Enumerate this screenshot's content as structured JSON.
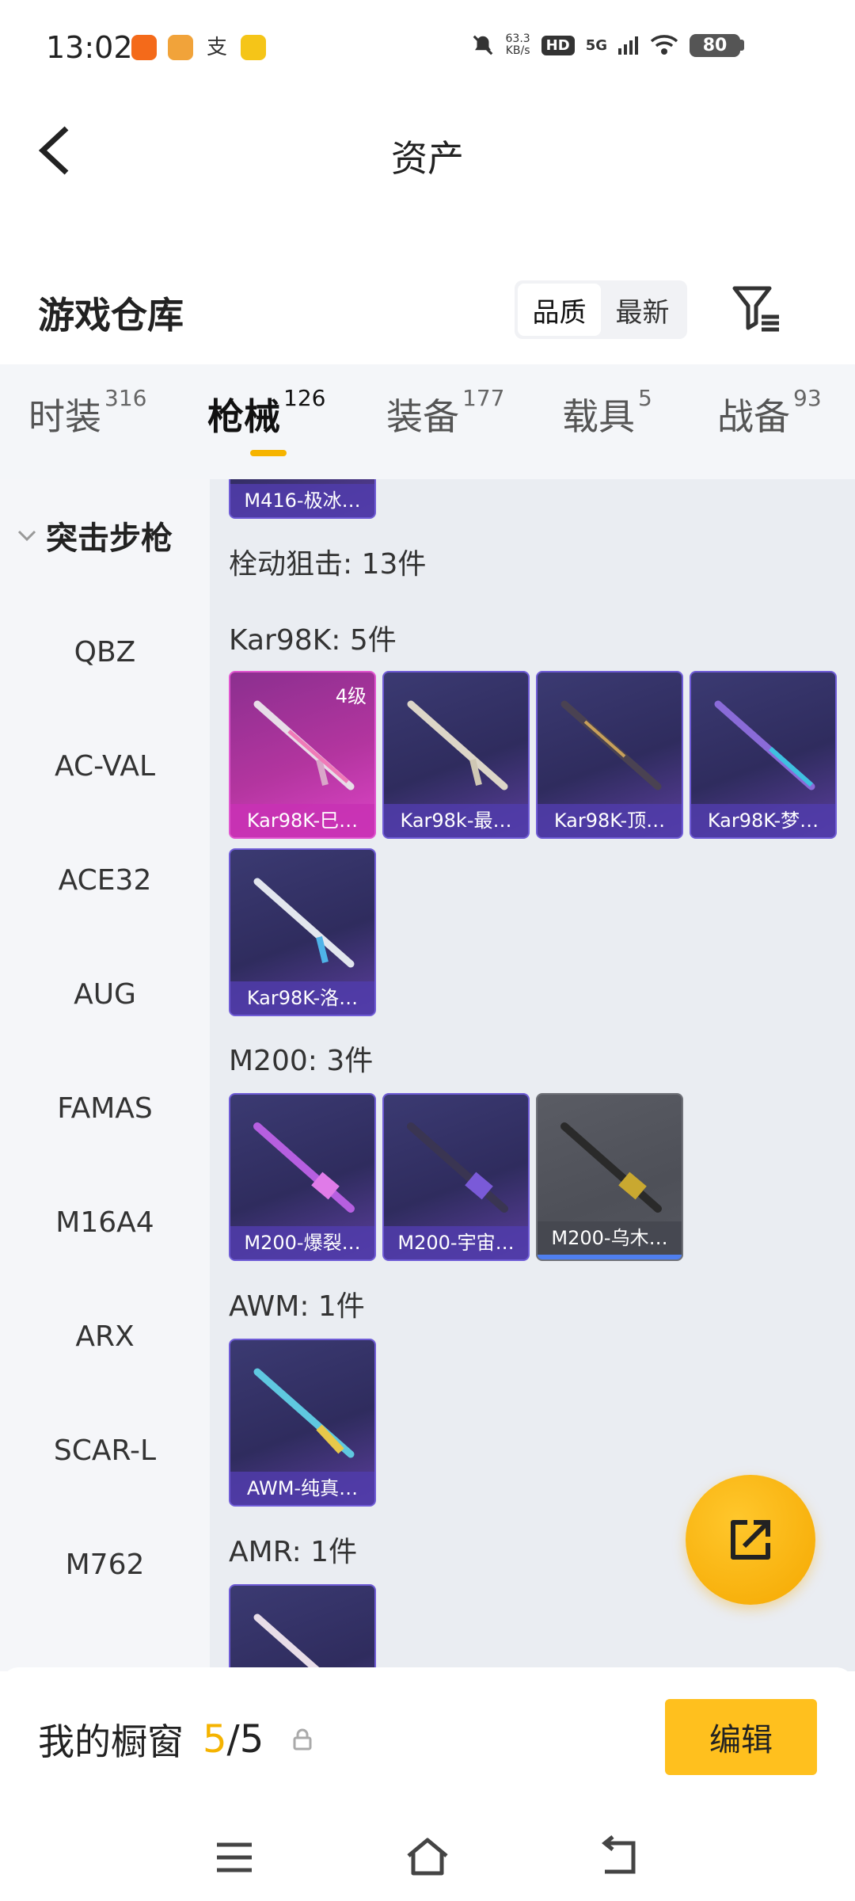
{
  "status_bar": {
    "time": "13:02",
    "app_icons": [
      "weibo-icon",
      "camera-app-icon",
      "alipay-icon",
      "game-app-icon"
    ],
    "net_speed_value": "63.3",
    "net_speed_unit": "KB/s",
    "hd_badge": "HD",
    "network": "5G",
    "battery": "80"
  },
  "header": {
    "title": "资产"
  },
  "warehouse": {
    "title": "游戏仓库",
    "sort_options": [
      "品质",
      "最新"
    ],
    "sort_selected": "品质"
  },
  "tabs": [
    {
      "label": "时装",
      "count": "316"
    },
    {
      "label": "枪械",
      "count": "126",
      "active": true
    },
    {
      "label": "装备",
      "count": "177"
    },
    {
      "label": "载具",
      "count": "5"
    },
    {
      "label": "战备",
      "count": "93"
    }
  ],
  "sidebar": {
    "category": "突击步枪",
    "items": [
      "QBZ",
      "AC-VAL",
      "ACE32",
      "AUG",
      "FAMAS",
      "M16A4",
      "ARX",
      "SCAR-L",
      "M762"
    ]
  },
  "content": {
    "top_partial_card": "M416-极冰…",
    "section_title": "栓动狙击: 13件",
    "groups": [
      {
        "label": "Kar98K: 5件",
        "items": [
          {
            "name": "Kar98K-巳…",
            "level": "4级",
            "rarity": "pink"
          },
          {
            "name": "Kar98k-最…",
            "rarity": "purple"
          },
          {
            "name": "Kar98K-顶…",
            "rarity": "purple"
          },
          {
            "name": "Kar98K-梦…",
            "rarity": "purple"
          },
          {
            "name": "Kar98K-洛…",
            "rarity": "purple"
          }
        ]
      },
      {
        "label": "M200: 3件",
        "items": [
          {
            "name": "M200-爆裂…",
            "rarity": "purple"
          },
          {
            "name": "M200-宇宙…",
            "rarity": "purple"
          },
          {
            "name": "M200-乌木…",
            "rarity": "grey"
          }
        ]
      },
      {
        "label": "AWM: 1件",
        "items": [
          {
            "name": "AWM-纯真…",
            "rarity": "purple"
          }
        ]
      },
      {
        "label": "AMR: 1件",
        "items": [
          {
            "name": "",
            "rarity": "purple"
          }
        ]
      }
    ]
  },
  "fab": {
    "icon": "share-icon"
  },
  "showcase": {
    "label": "我的橱窗",
    "current": "5",
    "total": "/5",
    "edit_label": "编辑"
  },
  "colors": {
    "accent": "#f5b300",
    "button": "#ffc01e",
    "rarity_pink": "#de44c8",
    "rarity_purple": "#6f5cd6",
    "rarity_grey": "#5a5c64"
  }
}
